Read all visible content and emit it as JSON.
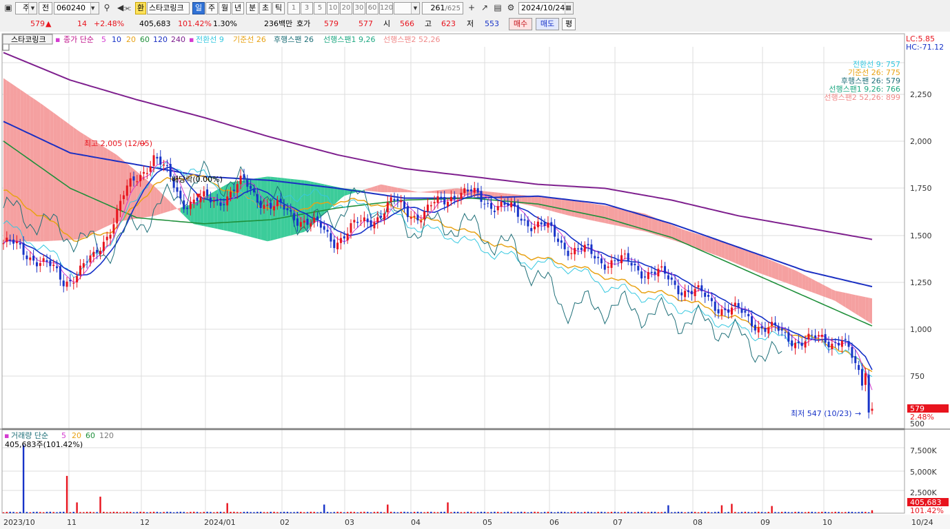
{
  "toolbar": {
    "period_type": "주",
    "market": "전",
    "code": "060240",
    "stock_name": "스타코링크",
    "interval_day": "일",
    "interval_week": "주",
    "interval_month": "월",
    "interval_year": "년",
    "interval_min": "분",
    "interval_sec": "초",
    "interval_tick": "틱",
    "multipliers": [
      "1",
      "3",
      "5",
      "10",
      "20",
      "30",
      "60",
      "120"
    ],
    "count": "261",
    "total": "/625",
    "date": "2024/10/24"
  },
  "quote": {
    "price": "579",
    "change_arrow": "▲",
    "change": "14",
    "change_rate": "+2.48%",
    "volume": "405,683",
    "volume_ratio": "101.42%",
    "turnover_rate": "1.30%",
    "amount": "236백만",
    "ask_label": "호가",
    "ask": "579",
    "bid": "577",
    "open_label": "시",
    "open": "566",
    "high_label": "고",
    "high": "623",
    "low_label": "저",
    "low": "553",
    "buy_label": "매수",
    "sell_label": "매도",
    "eval_label": "평"
  },
  "legend": {
    "stock": "스타코링크",
    "ma_label": "종가 단순",
    "ma_periods": [
      "5",
      "10",
      "20",
      "60",
      "120",
      "240"
    ],
    "ma_colors": [
      "#d43ad0",
      "#1430c8",
      "#e8a214",
      "#1e8f3a",
      "#1a2fc2",
      "#7e1f8e"
    ],
    "ichimoku": [
      {
        "text": "전환선 9",
        "color": "#35c8e0"
      },
      {
        "text": "기준선 26",
        "color": "#e8a214"
      },
      {
        "text": "후행스팬 26",
        "color": "#1e6f78"
      },
      {
        "text": "선행스팬1 9,26",
        "color": "#1ea882"
      },
      {
        "text": "선행스팬2 52,26",
        "color": "#f08a8a"
      }
    ],
    "lc": "LC:5.85",
    "hc": "HC:-71.12"
  },
  "ichimoku_values": [
    {
      "text": "전환선 9: 757",
      "color": "#35c8e0"
    },
    {
      "text": "기준선 26: 775",
      "color": "#e8a214"
    },
    {
      "text": "후행스팬 26: 579",
      "color": "#1e6f78"
    },
    {
      "text": "선행스팬1 9,26: 766",
      "color": "#1ea882"
    },
    {
      "text": "선행스팬2 52,26: 899",
      "color": "#f08a8a"
    }
  ],
  "annotations": {
    "high": "최고 2,005 (12/05)",
    "low": "최저 547 (10/23)",
    "dividend": "배당락(0.00%)"
  },
  "price_axis": [
    "2,250",
    "2,000",
    "1,750",
    "1,500",
    "1,250",
    "1,000",
    "750",
    "500"
  ],
  "current_price_tag": "579",
  "current_rate_tag": "2.48%",
  "volume_legend": {
    "label": "거래량 단순",
    "periods": [
      "5",
      "20",
      "60",
      "120"
    ],
    "colors": [
      "#d43ad0",
      "#e8a214",
      "#1e8f3a",
      "#7a7a7a"
    ],
    "value": "405,683주(101.42%)"
  },
  "volume_axis": [
    "7,500K",
    "5,000K",
    "2,500K"
  ],
  "volume_tag": "405,683",
  "volume_rate_tag": "101.42%",
  "date_axis": [
    "2023/10",
    "11",
    "12",
    "2024/01",
    "02",
    "03",
    "04",
    "05",
    "06",
    "07",
    "08",
    "09",
    "10",
    "10/24"
  ],
  "colors": {
    "up": "#e8141e",
    "down": "#1733c8",
    "cloud_red": "#f5a0a0",
    "cloud_green": "#3ccc9a"
  },
  "chart_data": {
    "type": "candlestick",
    "price_range": [
      500,
      2400
    ],
    "volume_range": [
      0,
      10000000
    ],
    "high": {
      "value": 2005,
      "date": "12/05"
    },
    "low": {
      "value": 547,
      "date": "10/23"
    },
    "last": {
      "open": 566,
      "high": 623,
      "low": 553,
      "close": 579,
      "volume": 405683
    },
    "ma240": [
      2390,
      2250,
      2150,
      2060,
      1960,
      1870,
      1800,
      1760,
      1720,
      1700,
      1640,
      1560,
      1500,
      1440
    ],
    "ma120": [
      2040,
      1880,
      1820,
      1760,
      1740,
      1700,
      1650,
      1650,
      1660,
      1620,
      1520,
      1400,
      1280,
      1200
    ],
    "ma60": [
      1940,
      1700,
      1550,
      1520,
      1540,
      1600,
      1640,
      1650,
      1620,
      1550,
      1450,
      1300,
      1150,
      1000
    ]
  }
}
